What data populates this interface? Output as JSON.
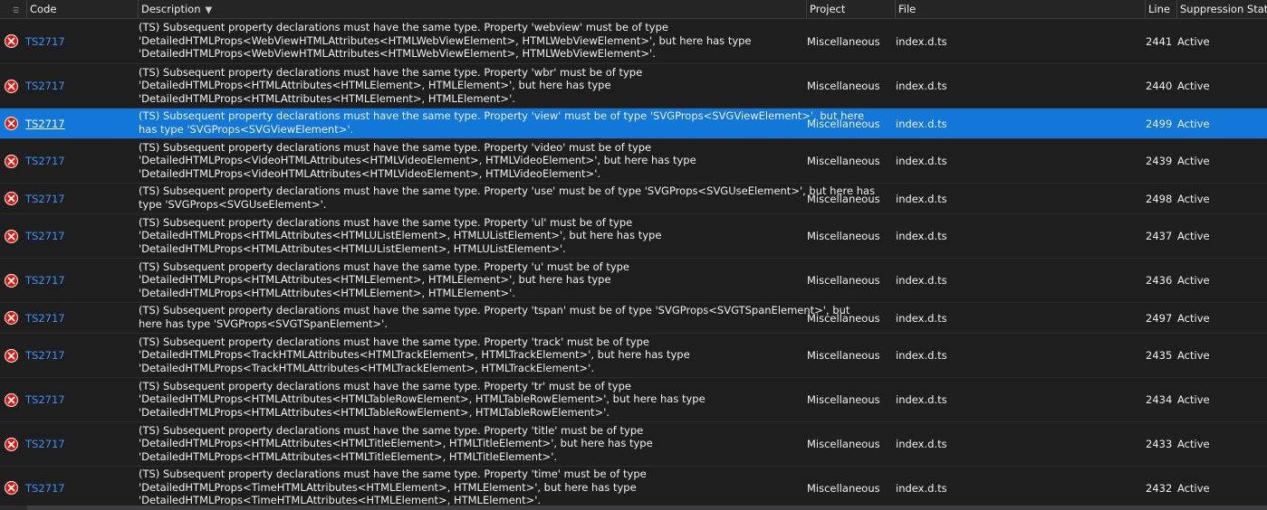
{
  "columns": {
    "code": "Code",
    "description": "Description",
    "project": "Project",
    "file": "File",
    "line": "Line",
    "state": "Suppression State"
  },
  "icons": {
    "filter": "filter-icon",
    "sort": "sort-descending-icon",
    "error": "error-icon"
  },
  "colors": {
    "selected_row": "#1177d8",
    "error_icon": "#e51400",
    "link": "#3794ff"
  },
  "rows": [
    {
      "code": "TS2717",
      "desc": [
        "(TS) Subsequent property declarations must have the same type.  Property 'webview' must be of type",
        "'DetailedHTMLProps<WebViewHTMLAttributes<HTMLWebViewElement>, HTMLWebViewElement>', but here has type",
        "'DetailedHTMLProps<WebViewHTMLAttributes<HTMLWebViewElement>, HTMLWebViewElement>'."
      ],
      "project": "Miscellaneous",
      "file": "index.d.ts",
      "line": "2441",
      "state": "Active",
      "selected": false
    },
    {
      "code": "TS2717",
      "desc": [
        "(TS) Subsequent property declarations must have the same type.  Property 'wbr' must be of type",
        "'DetailedHTMLProps<HTMLAttributes<HTMLElement>, HTMLElement>', but here has type",
        "'DetailedHTMLProps<HTMLAttributes<HTMLElement>, HTMLElement>'."
      ],
      "project": "Miscellaneous",
      "file": "index.d.ts",
      "line": "2440",
      "state": "Active",
      "selected": false
    },
    {
      "code": "TS2717",
      "desc": [
        "(TS) Subsequent property declarations must have the same type.  Property 'view' must be of type 'SVGProps<SVGViewElement>', but here",
        "has type 'SVGProps<SVGViewElement>'."
      ],
      "project": "Miscellaneous",
      "file": "index.d.ts",
      "line": "2499",
      "state": "Active",
      "selected": true
    },
    {
      "code": "TS2717",
      "desc": [
        "(TS) Subsequent property declarations must have the same type.  Property 'video' must be of type",
        "'DetailedHTMLProps<VideoHTMLAttributes<HTMLVideoElement>, HTMLVideoElement>', but here has type",
        "'DetailedHTMLProps<VideoHTMLAttributes<HTMLVideoElement>, HTMLVideoElement>'."
      ],
      "project": "Miscellaneous",
      "file": "index.d.ts",
      "line": "2439",
      "state": "Active",
      "selected": false
    },
    {
      "code": "TS2717",
      "desc": [
        "(TS) Subsequent property declarations must have the same type.  Property 'use' must be of type 'SVGProps<SVGUseElement>', but here has",
        "type 'SVGProps<SVGUseElement>'."
      ],
      "project": "Miscellaneous",
      "file": "index.d.ts",
      "line": "2498",
      "state": "Active",
      "selected": false
    },
    {
      "code": "TS2717",
      "desc": [
        "(TS) Subsequent property declarations must have the same type.  Property 'ul' must be of type",
        "'DetailedHTMLProps<HTMLAttributes<HTMLUListElement>, HTMLUListElement>', but here has type",
        "'DetailedHTMLProps<HTMLAttributes<HTMLUListElement>, HTMLUListElement>'."
      ],
      "project": "Miscellaneous",
      "file": "index.d.ts",
      "line": "2437",
      "state": "Active",
      "selected": false
    },
    {
      "code": "TS2717",
      "desc": [
        "(TS) Subsequent property declarations must have the same type.  Property 'u' must be of type",
        "'DetailedHTMLProps<HTMLAttributes<HTMLElement>, HTMLElement>', but here has type",
        "'DetailedHTMLProps<HTMLAttributes<HTMLElement>, HTMLElement>'."
      ],
      "project": "Miscellaneous",
      "file": "index.d.ts",
      "line": "2436",
      "state": "Active",
      "selected": false
    },
    {
      "code": "TS2717",
      "desc": [
        "(TS) Subsequent property declarations must have the same type.  Property 'tspan' must be of type 'SVGProps<SVGTSpanElement>', but",
        "here has type 'SVGProps<SVGTSpanElement>'."
      ],
      "project": "Miscellaneous",
      "file": "index.d.ts",
      "line": "2497",
      "state": "Active",
      "selected": false
    },
    {
      "code": "TS2717",
      "desc": [
        "(TS) Subsequent property declarations must have the same type.  Property 'track' must be of type",
        "'DetailedHTMLProps<TrackHTMLAttributes<HTMLTrackElement>, HTMLTrackElement>', but here has type",
        "'DetailedHTMLProps<TrackHTMLAttributes<HTMLTrackElement>, HTMLTrackElement>'."
      ],
      "project": "Miscellaneous",
      "file": "index.d.ts",
      "line": "2435",
      "state": "Active",
      "selected": false
    },
    {
      "code": "TS2717",
      "desc": [
        "(TS) Subsequent property declarations must have the same type.  Property 'tr' must be of type",
        "'DetailedHTMLProps<HTMLAttributes<HTMLTableRowElement>, HTMLTableRowElement>', but here has type",
        "'DetailedHTMLProps<HTMLAttributes<HTMLTableRowElement>, HTMLTableRowElement>'."
      ],
      "project": "Miscellaneous",
      "file": "index.d.ts",
      "line": "2434",
      "state": "Active",
      "selected": false
    },
    {
      "code": "TS2717",
      "desc": [
        "(TS) Subsequent property declarations must have the same type.  Property 'title' must be of type",
        "'DetailedHTMLProps<HTMLAttributes<HTMLTitleElement>, HTMLTitleElement>', but here has type",
        "'DetailedHTMLProps<HTMLAttributes<HTMLTitleElement>, HTMLTitleElement>'."
      ],
      "project": "Miscellaneous",
      "file": "index.d.ts",
      "line": "2433",
      "state": "Active",
      "selected": false
    },
    {
      "code": "TS2717",
      "desc": [
        "(TS) Subsequent property declarations must have the same type.  Property 'time' must be of type",
        "'DetailedHTMLProps<TimeHTMLAttributes<HTMLElement>, HTMLElement>', but here has type",
        "'DetailedHTMLProps<TimeHTMLAttributes<HTMLElement>, HTMLElement>'."
      ],
      "project": "Miscellaneous",
      "file": "index.d.ts",
      "line": "2432",
      "state": "Active",
      "selected": false
    }
  ]
}
